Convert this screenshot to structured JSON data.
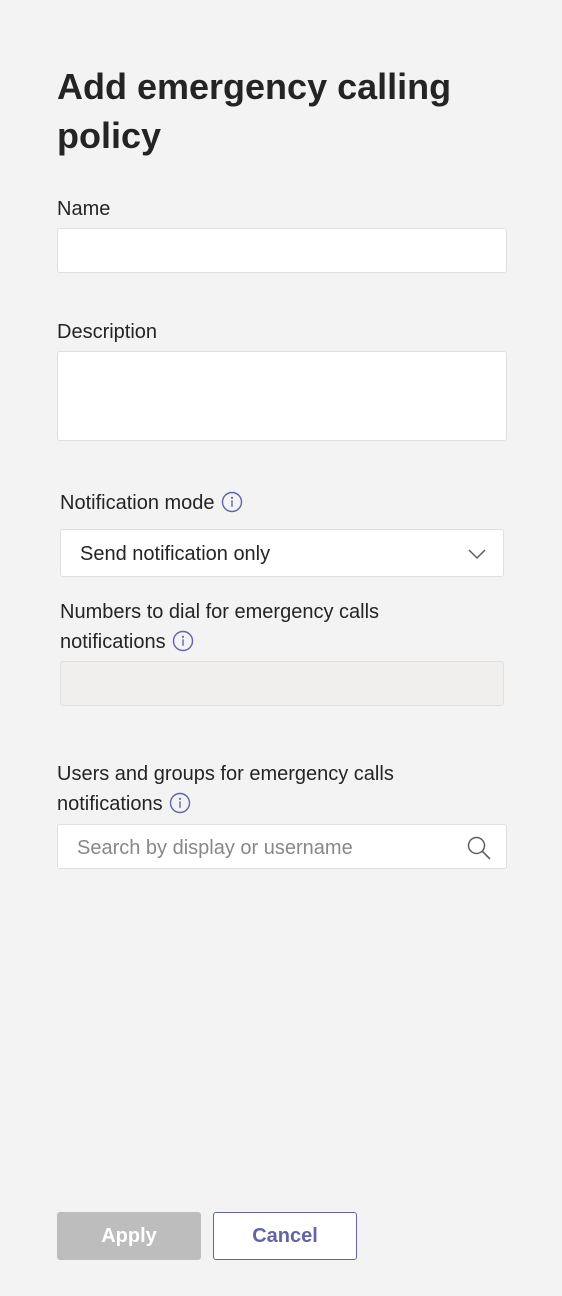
{
  "dialog": {
    "title": "Add emergency calling policy"
  },
  "fields": {
    "name": {
      "label": "Name",
      "value": ""
    },
    "description": {
      "label": "Description",
      "value": ""
    },
    "notification_mode": {
      "label": "Notification mode",
      "selected": "Send notification only",
      "icon": "info-icon"
    },
    "numbers_to_dial": {
      "label_line1": "Numbers to dial for emergency calls",
      "label_line2": "notifications",
      "value": "",
      "icon": "info-icon"
    },
    "users_groups": {
      "label_line1": "Users and groups for emergency calls",
      "label_line2": "notifications",
      "placeholder": "Search by display or username",
      "icon": "info-icon",
      "search_icon": "search-icon"
    }
  },
  "actions": {
    "apply_label": "Apply",
    "cancel_label": "Cancel"
  },
  "colors": {
    "accent": "#6264a7",
    "disabled_button": "#bdbdbd",
    "background": "#f3f3f3"
  }
}
